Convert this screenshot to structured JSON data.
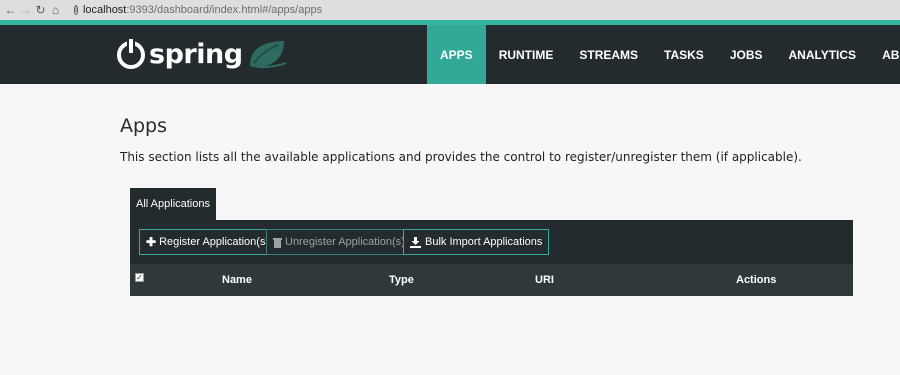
{
  "browser": {
    "url_host": "localhost",
    "url_rest": ":9393/dashboard/index.html#/apps/apps"
  },
  "header": {
    "logo_text": "spring",
    "nav": [
      {
        "label": "APPS",
        "active": true
      },
      {
        "label": "RUNTIME"
      },
      {
        "label": "STREAMS"
      },
      {
        "label": "TASKS"
      },
      {
        "label": "JOBS"
      },
      {
        "label": "ANALYTICS"
      },
      {
        "label": "ABOUT"
      }
    ]
  },
  "page": {
    "title": "Apps",
    "description": "This section lists all the available applications and provides the control to register/unregister them (if applicable)."
  },
  "tabs": [
    {
      "label": "All Applications",
      "active": true
    }
  ],
  "toolbar": {
    "register_label": "Register Application(s)",
    "unregister_label": "Unregister Application(s)",
    "bulk_import_label": "Bulk Import Applications"
  },
  "table": {
    "columns": [
      "Name",
      "Type",
      "URI",
      "Actions"
    ]
  },
  "colors": {
    "accent": "#34b49f",
    "header_bg": "#232b2e",
    "active_nav": "#32a998"
  }
}
